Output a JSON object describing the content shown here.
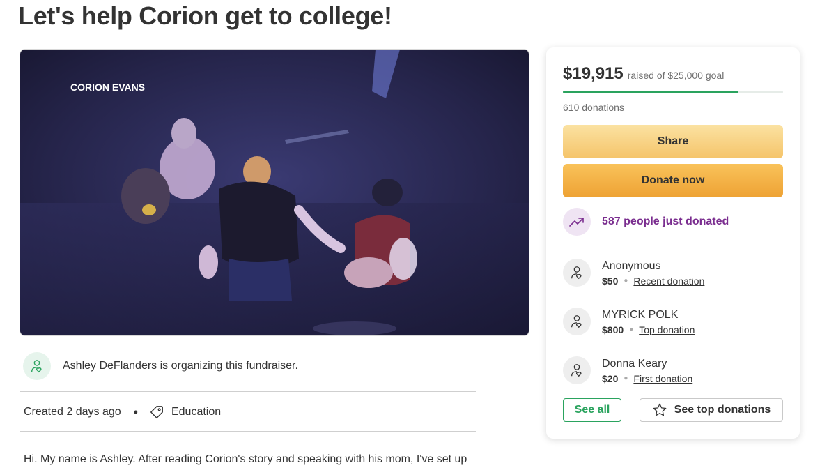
{
  "page": {
    "title": "Let's help Corion get to college!"
  },
  "hero": {
    "overlay_caption": "CORION EVANS"
  },
  "organizer": {
    "text": "Ashley DeFlanders is organizing this fundraiser.",
    "icon": "person-heart-icon"
  },
  "meta": {
    "created": "Created 2 days ago",
    "separator": "•",
    "category": "Education",
    "category_icon": "tag-icon"
  },
  "story": {
    "text": "Hi. My name is Ashley. After reading Corion's story and speaking with his mom, I've set up"
  },
  "donation_card": {
    "raised_amount": "$19,915",
    "goal_text": "raised of $25,000 goal",
    "progress_percent": 79.66,
    "donation_count": "610 donations",
    "share_label": "Share",
    "donate_label": "Donate now",
    "just_donated": "587 people just donated",
    "donors": [
      {
        "name": "Anonymous",
        "amount": "$50",
        "label": "Recent donation"
      },
      {
        "name": "MYRICK POLK",
        "amount": "$800",
        "label": "Top donation"
      },
      {
        "name": "Donna Keary",
        "amount": "$20",
        "label": "First donation"
      }
    ],
    "see_all_label": "See all",
    "see_top_label": "See top donations"
  },
  "colors": {
    "brand_green": "#2aa35e",
    "donate_orange": "#eea234",
    "share_yellow": "#f5c46a",
    "purple_accent": "#7a2d8f"
  }
}
